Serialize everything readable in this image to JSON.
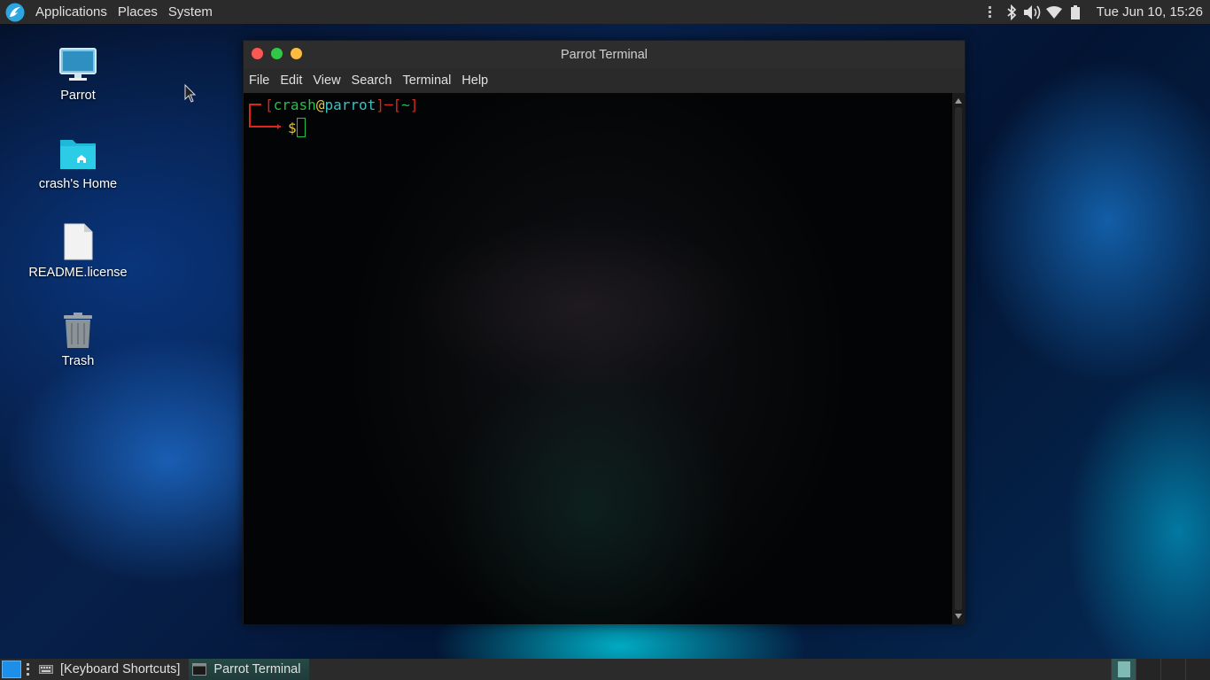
{
  "top_panel": {
    "menus": [
      "Applications",
      "Places",
      "System"
    ],
    "clock": "Tue Jun 10, 15:26"
  },
  "desktop": {
    "icons": [
      {
        "label": "Parrot",
        "icon": "computer-icon"
      },
      {
        "label": "crash's Home",
        "icon": "home-folder-icon"
      },
      {
        "label": "README.license",
        "icon": "file-icon"
      },
      {
        "label": "Trash",
        "icon": "trash-icon"
      }
    ]
  },
  "terminal": {
    "title": "Parrot Terminal",
    "menus": [
      "File",
      "Edit",
      "View",
      "Search",
      "Terminal",
      "Help"
    ],
    "prompt": {
      "user": "crash",
      "at": "@",
      "host": "parrot",
      "dir": "~",
      "symbol": "$"
    }
  },
  "taskbar": {
    "tasks": [
      "[Keyboard Shortcuts]",
      "Parrot Terminal"
    ]
  },
  "colors": {
    "panel": "#2b2b2b",
    "prompt_red": "#e0231b",
    "prompt_green": "#23c04a",
    "prompt_cyan": "#3bc1c4",
    "accent": "#1d8fe8"
  }
}
